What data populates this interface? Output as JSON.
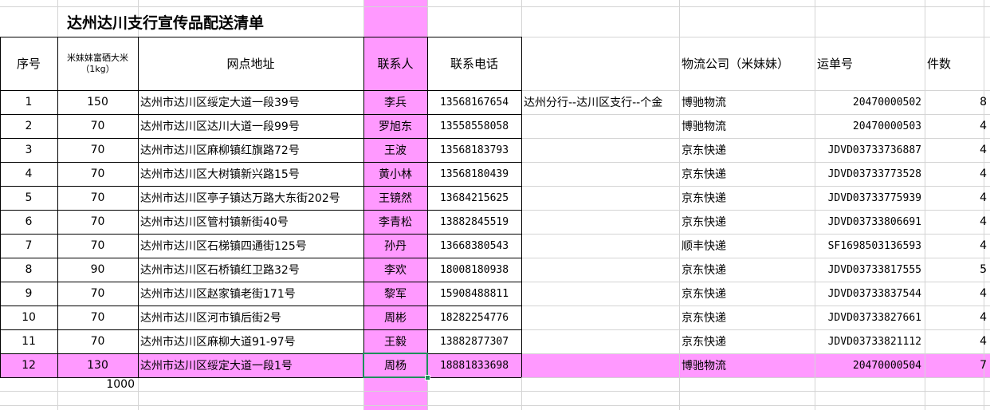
{
  "sheet": {
    "title": "达州达川支行宣传品配送清单",
    "headers": {
      "seq": "序号",
      "rice_line1": "米妹妹富硒大米",
      "rice_line2": "（1kg）",
      "address": "网点地址",
      "contact": "联系人",
      "phone": "联系电话",
      "note": "",
      "logistics": "物流公司（米妹妹）",
      "waybill": "运单号",
      "count": "件数"
    },
    "rows": [
      {
        "seq": "1",
        "qty": "150",
        "address": "达州市达川区绥定大道一段39号",
        "contact": "李兵",
        "phone": "13568167654",
        "note": "达州分行--达川区支行--个金",
        "logistics": "博驰物流",
        "waybill": "20470000502",
        "count": "8"
      },
      {
        "seq": "2",
        "qty": "70",
        "address": "达州市达川区达川大道一段99号",
        "contact": "罗旭东",
        "phone": "13558558058",
        "note": "",
        "logistics": "博驰物流",
        "waybill": "20470000503",
        "count": "4"
      },
      {
        "seq": "3",
        "qty": "70",
        "address": "达州市达川区麻柳镇红旗路72号",
        "contact": "王波",
        "phone": "13568183793",
        "note": "",
        "logistics": "京东快递",
        "waybill": "JDVD03733736887",
        "count": "4"
      },
      {
        "seq": "4",
        "qty": "70",
        "address": "达州市达川区大树镇新兴路15号",
        "contact": "黄小林",
        "phone": "13568180439",
        "note": "",
        "logistics": "京东快递",
        "waybill": "JDVD03733773528",
        "count": "4"
      },
      {
        "seq": "5",
        "qty": "70",
        "address": "达州市达川区亭子镇达万路大东街202号",
        "contact": "王镜然",
        "phone": "13684215625",
        "note": "",
        "logistics": "京东快递",
        "waybill": "JDVD03733775939",
        "count": "4"
      },
      {
        "seq": "6",
        "qty": "70",
        "address": "达州市达川区管村镇新街40号",
        "contact": "李青松",
        "phone": "13882845519",
        "note": "",
        "logistics": "京东快递",
        "waybill": "JDVD03733806691",
        "count": "4"
      },
      {
        "seq": "7",
        "qty": "70",
        "address": "达州市达川区石梯镇四通街125号",
        "contact": "孙丹",
        "phone": "13668380543",
        "note": "",
        "logistics": "顺丰快递",
        "waybill": "SF1698503136593",
        "count": "4"
      },
      {
        "seq": "8",
        "qty": "90",
        "address": "达州市达川区石桥镇红卫路32号",
        "contact": "李欢",
        "phone": "18008180938",
        "note": "",
        "logistics": "京东快递",
        "waybill": "JDVD03733817555",
        "count": "5"
      },
      {
        "seq": "9",
        "qty": "70",
        "address": "达州市达川区赵家镇老街171号",
        "contact": "黎军",
        "phone": "15908488811",
        "note": "",
        "logistics": "京东快递",
        "waybill": "JDVD03733837544",
        "count": "4"
      },
      {
        "seq": "10",
        "qty": "70",
        "address": "达州市达川区河市镇后街2号",
        "contact": "周彬",
        "phone": "18282254776",
        "note": "",
        "logistics": "京东快递",
        "waybill": "JDVD03733827661",
        "count": "4"
      },
      {
        "seq": "11",
        "qty": "70",
        "address": "达州市达川区麻柳大道91-97号",
        "contact": "王毅",
        "phone": "13882877307",
        "note": "",
        "logistics": "京东快递",
        "waybill": "JDVD03733821112",
        "count": "4"
      },
      {
        "seq": "12",
        "qty": "130",
        "address": "达州市达川区绥定大道一段1号",
        "contact": "周杨",
        "phone": "18881833698",
        "note": "",
        "logistics": "博驰物流",
        "waybill": "20470000504",
        "count": "7"
      }
    ],
    "total_qty": "1000",
    "colors": {
      "highlight": "#ff99ff",
      "selection": "#1e8f5a",
      "gridline": "#d4d4d4"
    }
  }
}
